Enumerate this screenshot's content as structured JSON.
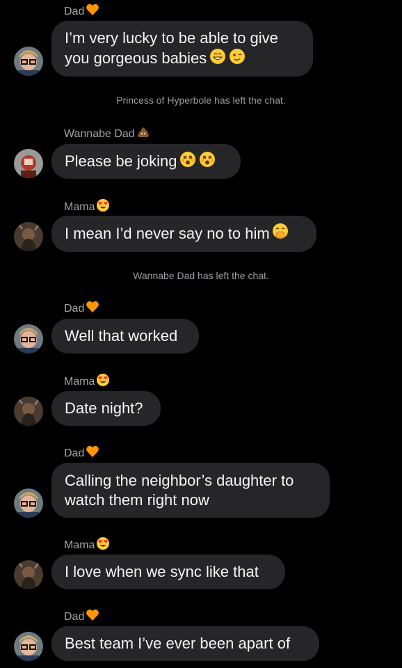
{
  "thread": [
    {
      "type": "sender",
      "name": "Dad",
      "badge": "orange-heart-icon"
    },
    {
      "type": "message",
      "lines": [
        "I’m very lucky to be able to give",
        "you gorgeous babies"
      ],
      "emojis": [
        "grinning-face-icon",
        "winking-face-icon"
      ],
      "avatar": "dad-avatar"
    },
    {
      "type": "system",
      "text": "Princess of Hyperbole has left the chat."
    },
    {
      "type": "sender",
      "name": "Wannabe Dad",
      "badge": "poop-icon"
    },
    {
      "type": "message",
      "lines": [
        "Please be joking"
      ],
      "emojis": [
        "dizzy-face-icon",
        "dizzy-face-icon"
      ],
      "avatar": "wannabe-dad-avatar"
    },
    {
      "type": "sender",
      "name": "Mama",
      "badge": "heart-eyes-icon"
    },
    {
      "type": "message",
      "lines": [
        "I mean I’d never say no to him"
      ],
      "emojis": [
        "hand-over-mouth-icon"
      ],
      "avatar": "mama-avatar"
    },
    {
      "type": "system",
      "text": "Wannabe Dad has left the chat."
    },
    {
      "type": "sender",
      "name": "Dad",
      "badge": "orange-heart-icon"
    },
    {
      "type": "message",
      "lines": [
        "Well that worked"
      ],
      "emojis": [],
      "avatar": "dad-avatar"
    },
    {
      "type": "sender",
      "name": "Mama",
      "badge": "heart-eyes-icon"
    },
    {
      "type": "message",
      "lines": [
        "Date night?"
      ],
      "emojis": [],
      "avatar": "mama-avatar"
    },
    {
      "type": "sender",
      "name": "Dad",
      "badge": "orange-heart-icon"
    },
    {
      "type": "message",
      "lines": [
        "Calling the neighbor’s daughter to",
        "watch them right now"
      ],
      "emojis": [],
      "avatar": "dad-avatar"
    },
    {
      "type": "sender",
      "name": "Mama",
      "badge": "heart-eyes-icon"
    },
    {
      "type": "message",
      "lines": [
        "I love when we sync like that"
      ],
      "emojis": [],
      "avatar": "mama-avatar"
    },
    {
      "type": "sender",
      "name": "Dad",
      "badge": "orange-heart-icon"
    },
    {
      "type": "message",
      "lines": [
        "Best team I’ve ever been apart of"
      ],
      "emojis": [],
      "avatar": "dad-avatar"
    }
  ],
  "colors": {
    "background": "#000000",
    "bubble": "#262629",
    "sender_text": "#a3a3a8",
    "system_text": "#9a9aa0"
  }
}
